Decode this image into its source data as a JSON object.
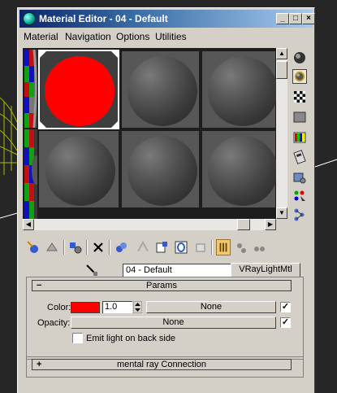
{
  "window": {
    "title": "Material Editor - 04 - Default",
    "min_glyph": "_",
    "max_glyph": "□",
    "close_glyph": "×"
  },
  "menu": [
    "Material",
    "Navigation",
    "Options",
    "Utilities"
  ],
  "material": {
    "name": "04 - Default",
    "type_button": "VRayLightMtl"
  },
  "rollouts": {
    "params": {
      "sign": "−",
      "title": "Params"
    },
    "mental_ray": {
      "sign": "+",
      "title": "mental ray Connection"
    }
  },
  "params": {
    "color_label": "Color:",
    "color_value": "#ff0000",
    "multiplier": "1.0",
    "color_map_button": "None",
    "color_map_checked": true,
    "opacity_label": "Opacity:",
    "opacity_map_button": "None",
    "opacity_map_checked": true,
    "emit_back_label": "Emit light on back side",
    "emit_back_checked": false,
    "check_glyph": "✓"
  },
  "colors": {
    "title_gradient_start": "#0a246a",
    "window_face": "#d4d0c8",
    "selected_sample": "#ff0000",
    "active_tool": "#f0c870"
  }
}
